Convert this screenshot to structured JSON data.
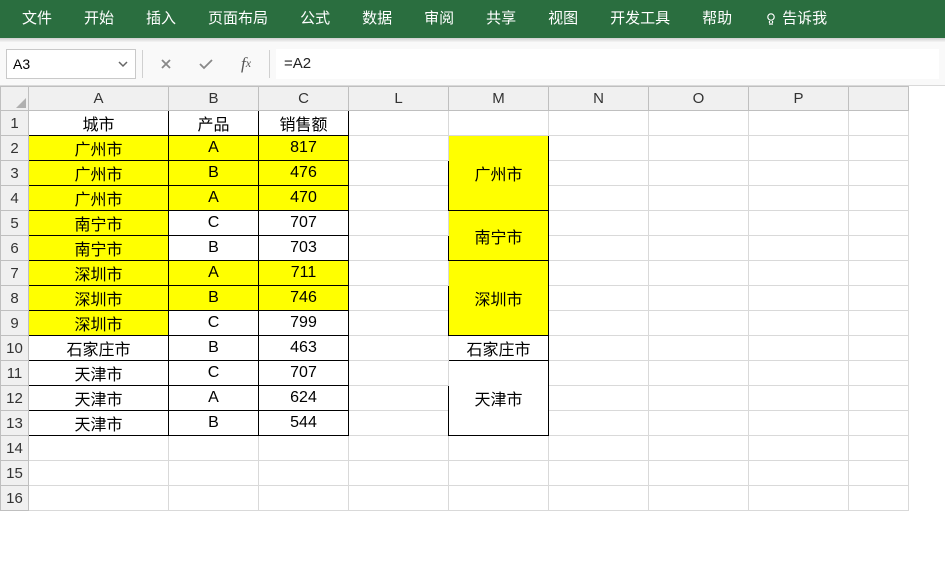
{
  "ribbon": {
    "tabs": [
      "文件",
      "开始",
      "插入",
      "页面布局",
      "公式",
      "数据",
      "审阅",
      "共享",
      "视图",
      "开发工具",
      "帮助"
    ],
    "tellMe": "告诉我"
  },
  "formulaBar": {
    "nameBox": "A3",
    "formula": "=A2"
  },
  "columns": [
    "A",
    "B",
    "C",
    "L",
    "M",
    "N",
    "O",
    "P"
  ],
  "rowCount": 16,
  "headers": {
    "A": "城市",
    "B": "产品",
    "C": "销售额"
  },
  "rows": [
    {
      "n": 2,
      "city": "广州市",
      "prod": "A",
      "sales": 817,
      "cityHL": true,
      "bcHL": true
    },
    {
      "n": 3,
      "city": "广州市",
      "prod": "B",
      "sales": 476,
      "cityHL": true,
      "bcHL": true
    },
    {
      "n": 4,
      "city": "广州市",
      "prod": "A",
      "sales": 470,
      "cityHL": true,
      "bcHL": true
    },
    {
      "n": 5,
      "city": "南宁市",
      "prod": "C",
      "sales": 707,
      "cityHL": true,
      "bcHL": false
    },
    {
      "n": 6,
      "city": "南宁市",
      "prod": "B",
      "sales": 703,
      "cityHL": true,
      "bcHL": false
    },
    {
      "n": 7,
      "city": "深圳市",
      "prod": "A",
      "sales": 711,
      "cityHL": true,
      "bcHL": true
    },
    {
      "n": 8,
      "city": "深圳市",
      "prod": "B",
      "sales": 746,
      "cityHL": true,
      "bcHL": true
    },
    {
      "n": 9,
      "city": "深圳市",
      "prod": "C",
      "sales": 799,
      "cityHL": true,
      "bcHL": false
    },
    {
      "n": 10,
      "city": "石家庄市",
      "prod": "B",
      "sales": 463,
      "cityHL": false,
      "bcHL": false
    },
    {
      "n": 11,
      "city": "天津市",
      "prod": "C",
      "sales": 707,
      "cityHL": false,
      "bcHL": false
    },
    {
      "n": 12,
      "city": "天津市",
      "prod": "A",
      "sales": 624,
      "cityHL": false,
      "bcHL": false
    },
    {
      "n": 13,
      "city": "天津市",
      "prod": "B",
      "sales": 544,
      "cityHL": false,
      "bcHL": false
    }
  ],
  "merged": [
    {
      "label": "广州市",
      "rowspan": 3,
      "hl": true
    },
    {
      "label": "南宁市",
      "rowspan": 2,
      "hl": true
    },
    {
      "label": "深圳市",
      "rowspan": 3,
      "hl": true
    },
    {
      "label": "石家庄市",
      "rowspan": 1,
      "hl": false
    },
    {
      "label": "天津市",
      "rowspan": 3,
      "hl": false
    }
  ]
}
